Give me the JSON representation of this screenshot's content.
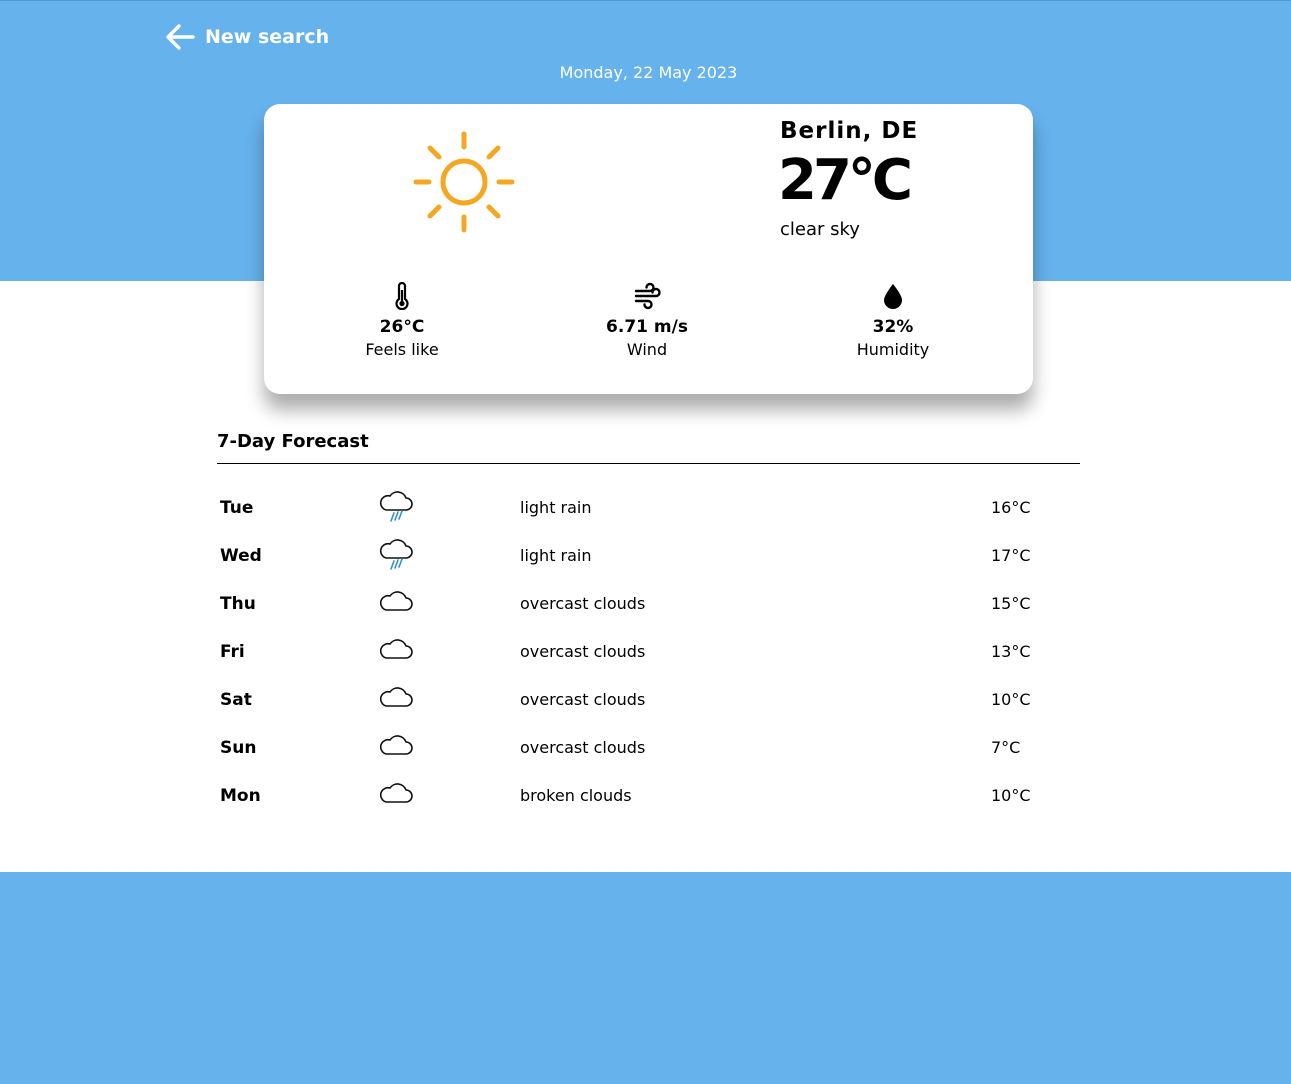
{
  "header": {
    "back_label": "New search",
    "date": "Monday, 22 May 2023"
  },
  "current": {
    "city": "Berlin, DE",
    "temperature": "27°C",
    "description": "clear sky",
    "icon": "sun-icon",
    "stats": [
      {
        "icon": "thermometer-icon",
        "value": "26°C",
        "label": "Feels like"
      },
      {
        "icon": "wind-icon",
        "value": "6.71 m/s",
        "label": "Wind"
      },
      {
        "icon": "droplet-icon",
        "value": "32%",
        "label": "Humidity"
      }
    ]
  },
  "forecast": {
    "title": "7-Day Forecast",
    "days": [
      {
        "day": "Tue",
        "icon": "rain-cloud-icon",
        "description": "light rain",
        "temp": "16°C"
      },
      {
        "day": "Wed",
        "icon": "rain-cloud-icon",
        "description": "light rain",
        "temp": "17°C"
      },
      {
        "day": "Thu",
        "icon": "cloud-icon",
        "description": "overcast clouds",
        "temp": "15°C"
      },
      {
        "day": "Fri",
        "icon": "cloud-icon",
        "description": "overcast clouds",
        "temp": "13°C"
      },
      {
        "day": "Sat",
        "icon": "cloud-icon",
        "description": "overcast clouds",
        "temp": "10°C"
      },
      {
        "day": "Sun",
        "icon": "cloud-icon",
        "description": "overcast clouds",
        "temp": "7°C"
      },
      {
        "day": "Mon",
        "icon": "cloud-icon",
        "description": "broken clouds",
        "temp": "10°C"
      }
    ]
  },
  "colors": {
    "background_band": "#66b2ec",
    "sun": "#f5a623",
    "rain": "#2f8fd6"
  }
}
